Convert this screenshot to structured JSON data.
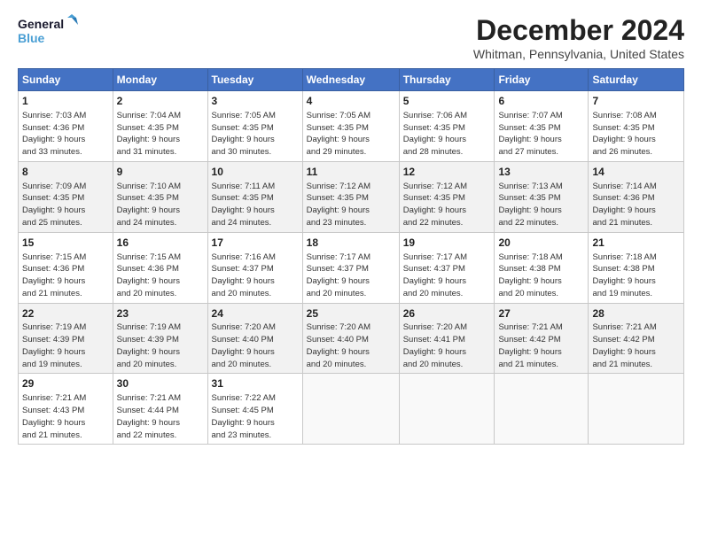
{
  "logo": {
    "line1": "General",
    "line2": "Blue"
  },
  "title": "December 2024",
  "subtitle": "Whitman, Pennsylvania, United States",
  "columns": [
    "Sunday",
    "Monday",
    "Tuesday",
    "Wednesday",
    "Thursday",
    "Friday",
    "Saturday"
  ],
  "weeks": [
    [
      {
        "day": "1",
        "info": "Sunrise: 7:03 AM\nSunset: 4:36 PM\nDaylight: 9 hours\nand 33 minutes."
      },
      {
        "day": "2",
        "info": "Sunrise: 7:04 AM\nSunset: 4:35 PM\nDaylight: 9 hours\nand 31 minutes."
      },
      {
        "day": "3",
        "info": "Sunrise: 7:05 AM\nSunset: 4:35 PM\nDaylight: 9 hours\nand 30 minutes."
      },
      {
        "day": "4",
        "info": "Sunrise: 7:05 AM\nSunset: 4:35 PM\nDaylight: 9 hours\nand 29 minutes."
      },
      {
        "day": "5",
        "info": "Sunrise: 7:06 AM\nSunset: 4:35 PM\nDaylight: 9 hours\nand 28 minutes."
      },
      {
        "day": "6",
        "info": "Sunrise: 7:07 AM\nSunset: 4:35 PM\nDaylight: 9 hours\nand 27 minutes."
      },
      {
        "day": "7",
        "info": "Sunrise: 7:08 AM\nSunset: 4:35 PM\nDaylight: 9 hours\nand 26 minutes."
      }
    ],
    [
      {
        "day": "8",
        "info": "Sunrise: 7:09 AM\nSunset: 4:35 PM\nDaylight: 9 hours\nand 25 minutes."
      },
      {
        "day": "9",
        "info": "Sunrise: 7:10 AM\nSunset: 4:35 PM\nDaylight: 9 hours\nand 24 minutes."
      },
      {
        "day": "10",
        "info": "Sunrise: 7:11 AM\nSunset: 4:35 PM\nDaylight: 9 hours\nand 24 minutes."
      },
      {
        "day": "11",
        "info": "Sunrise: 7:12 AM\nSunset: 4:35 PM\nDaylight: 9 hours\nand 23 minutes."
      },
      {
        "day": "12",
        "info": "Sunrise: 7:12 AM\nSunset: 4:35 PM\nDaylight: 9 hours\nand 22 minutes."
      },
      {
        "day": "13",
        "info": "Sunrise: 7:13 AM\nSunset: 4:35 PM\nDaylight: 9 hours\nand 22 minutes."
      },
      {
        "day": "14",
        "info": "Sunrise: 7:14 AM\nSunset: 4:36 PM\nDaylight: 9 hours\nand 21 minutes."
      }
    ],
    [
      {
        "day": "15",
        "info": "Sunrise: 7:15 AM\nSunset: 4:36 PM\nDaylight: 9 hours\nand 21 minutes."
      },
      {
        "day": "16",
        "info": "Sunrise: 7:15 AM\nSunset: 4:36 PM\nDaylight: 9 hours\nand 20 minutes."
      },
      {
        "day": "17",
        "info": "Sunrise: 7:16 AM\nSunset: 4:37 PM\nDaylight: 9 hours\nand 20 minutes."
      },
      {
        "day": "18",
        "info": "Sunrise: 7:17 AM\nSunset: 4:37 PM\nDaylight: 9 hours\nand 20 minutes."
      },
      {
        "day": "19",
        "info": "Sunrise: 7:17 AM\nSunset: 4:37 PM\nDaylight: 9 hours\nand 20 minutes."
      },
      {
        "day": "20",
        "info": "Sunrise: 7:18 AM\nSunset: 4:38 PM\nDaylight: 9 hours\nand 20 minutes."
      },
      {
        "day": "21",
        "info": "Sunrise: 7:18 AM\nSunset: 4:38 PM\nDaylight: 9 hours\nand 19 minutes."
      }
    ],
    [
      {
        "day": "22",
        "info": "Sunrise: 7:19 AM\nSunset: 4:39 PM\nDaylight: 9 hours\nand 19 minutes."
      },
      {
        "day": "23",
        "info": "Sunrise: 7:19 AM\nSunset: 4:39 PM\nDaylight: 9 hours\nand 20 minutes."
      },
      {
        "day": "24",
        "info": "Sunrise: 7:20 AM\nSunset: 4:40 PM\nDaylight: 9 hours\nand 20 minutes."
      },
      {
        "day": "25",
        "info": "Sunrise: 7:20 AM\nSunset: 4:40 PM\nDaylight: 9 hours\nand 20 minutes."
      },
      {
        "day": "26",
        "info": "Sunrise: 7:20 AM\nSunset: 4:41 PM\nDaylight: 9 hours\nand 20 minutes."
      },
      {
        "day": "27",
        "info": "Sunrise: 7:21 AM\nSunset: 4:42 PM\nDaylight: 9 hours\nand 21 minutes."
      },
      {
        "day": "28",
        "info": "Sunrise: 7:21 AM\nSunset: 4:42 PM\nDaylight: 9 hours\nand 21 minutes."
      }
    ],
    [
      {
        "day": "29",
        "info": "Sunrise: 7:21 AM\nSunset: 4:43 PM\nDaylight: 9 hours\nand 21 minutes."
      },
      {
        "day": "30",
        "info": "Sunrise: 7:21 AM\nSunset: 4:44 PM\nDaylight: 9 hours\nand 22 minutes."
      },
      {
        "day": "31",
        "info": "Sunrise: 7:22 AM\nSunset: 4:45 PM\nDaylight: 9 hours\nand 23 minutes."
      },
      {
        "day": "",
        "info": ""
      },
      {
        "day": "",
        "info": ""
      },
      {
        "day": "",
        "info": ""
      },
      {
        "day": "",
        "info": ""
      }
    ]
  ]
}
